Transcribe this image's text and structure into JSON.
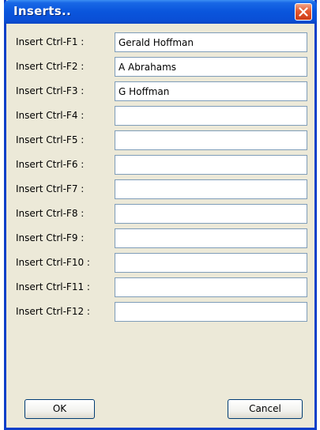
{
  "window": {
    "title": "Inserts.."
  },
  "rows": [
    {
      "label": "Insert Ctrl-F1 :",
      "value": "Gerald Hoffman"
    },
    {
      "label": "Insert Ctrl-F2 :",
      "value": "A Abrahams"
    },
    {
      "label": "Insert Ctrl-F3 :",
      "value": "G Hoffman"
    },
    {
      "label": "Insert Ctrl-F4 :",
      "value": ""
    },
    {
      "label": "Insert Ctrl-F5 :",
      "value": ""
    },
    {
      "label": "Insert Ctrl-F6 :",
      "value": ""
    },
    {
      "label": "Insert Ctrl-F7 :",
      "value": ""
    },
    {
      "label": "Insert Ctrl-F8 :",
      "value": ""
    },
    {
      "label": "Insert Ctrl-F9 :",
      "value": ""
    },
    {
      "label": "Insert Ctrl-F10 :",
      "value": ""
    },
    {
      "label": "Insert Ctrl-F11 :",
      "value": ""
    },
    {
      "label": "Insert Ctrl-F12 :",
      "value": ""
    }
  ],
  "buttons": {
    "ok_label": "OK",
    "cancel_label": "Cancel"
  },
  "icons": {
    "close": "close-icon"
  },
  "colors": {
    "titlebar": "#0a55dc",
    "close_button": "#e5582f",
    "dialog_background": "#ece9d8"
  }
}
